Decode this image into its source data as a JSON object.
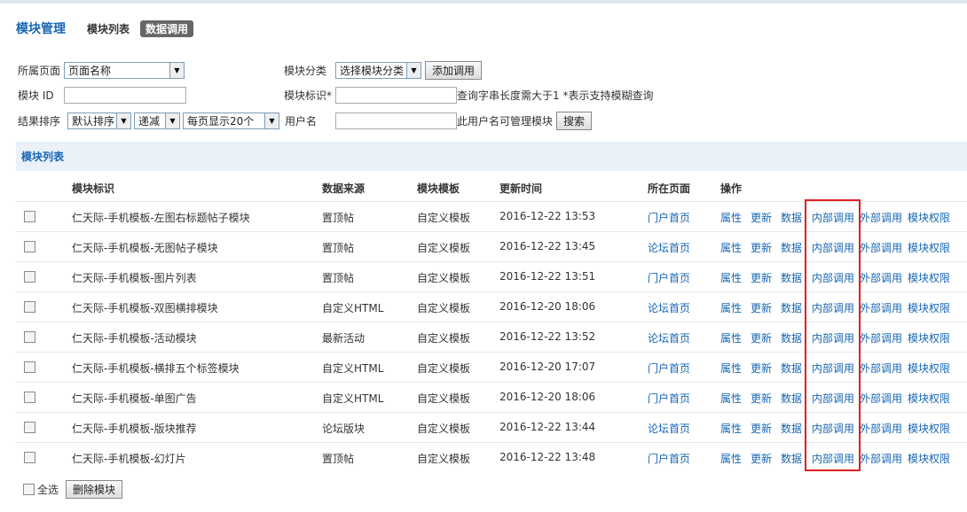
{
  "header": {
    "title": "模块管理",
    "tabs": [
      {
        "label": "模块列表",
        "active": false
      },
      {
        "label": "数据调用",
        "active": true
      }
    ]
  },
  "filters": {
    "page_label": "所属页面",
    "page_select": "页面名称",
    "category_label": "模块分类",
    "category_select": "选择模块分类",
    "add_button": "添加调用",
    "module_id_label": "模块 ID",
    "module_id_value": "",
    "module_tag_label": "模块标识*",
    "module_tag_value": "",
    "query_hint": "查询字串长度需大于1  *表示支持模糊查询",
    "sort_label": "结果排序",
    "sort_select": "默认排序",
    "order_select": "递减",
    "per_page_select": "每页显示20个",
    "username_label": "用户名",
    "username_value": "",
    "username_hint": "此用户名可管理模块",
    "search_button": "搜索"
  },
  "section_title": "模块列表",
  "table": {
    "columns": [
      "模块标识",
      "数据来源",
      "模块模板",
      "更新时间",
      "所在页面",
      "操作"
    ],
    "actions": [
      "属性",
      "更新",
      "数据",
      "内部调用",
      "外部调用",
      "模块权限"
    ],
    "rows": [
      {
        "name": "仁天际-手机模板-左图右标题帖子模块",
        "source": "置顶帖",
        "template": "自定义模板",
        "time": "2016-12-22 13:53",
        "page": "门户首页"
      },
      {
        "name": "仁天际-手机模板-无图帖子模块",
        "source": "置顶帖",
        "template": "自定义模板",
        "time": "2016-12-22 13:45",
        "page": "论坛首页"
      },
      {
        "name": "仁天际-手机模板-图片列表",
        "source": "置顶帖",
        "template": "自定义模板",
        "time": "2016-12-22 13:51",
        "page": "门户首页"
      },
      {
        "name": "仁天际-手机模板-双图横排模块",
        "source": "自定义HTML",
        "template": "自定义模板",
        "time": "2016-12-20 18:06",
        "page": "论坛首页"
      },
      {
        "name": "仁天际-手机模板-活动模块",
        "source": "最新活动",
        "template": "自定义模板",
        "time": "2016-12-22 13:52",
        "page": "论坛首页"
      },
      {
        "name": "仁天际-手机模板-横排五个标签模块",
        "source": "自定义HTML",
        "template": "自定义模板",
        "time": "2016-12-20 17:07",
        "page": "门户首页"
      },
      {
        "name": "仁天际-手机模板-单图广告",
        "source": "自定义HTML",
        "template": "自定义模板",
        "time": "2016-12-20 18:06",
        "page": "门户首页"
      },
      {
        "name": "仁天际-手机模板-版块推荐",
        "source": "论坛版块",
        "template": "自定义模板",
        "time": "2016-12-22 13:44",
        "page": "论坛首页"
      },
      {
        "name": "仁天际-手机模板-幻灯片",
        "source": "置顶帖",
        "template": "自定义模板",
        "time": "2016-12-22 13:48",
        "page": "门户首页"
      }
    ]
  },
  "footer": {
    "select_all": "全选",
    "delete_button": "删除模块"
  },
  "colors": {
    "link": "#1766b3",
    "highlight": "#e02020",
    "section_bg": "#eaf1f9"
  }
}
